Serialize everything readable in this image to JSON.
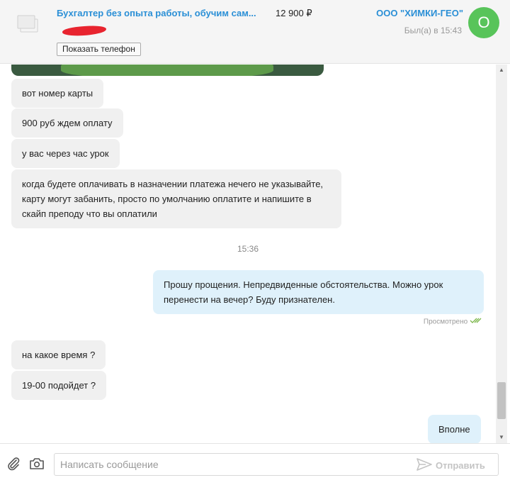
{
  "header": {
    "listing_title": "Бухгалтер без опыта работы, обучим сам...",
    "listing_price": "12 900 ₽",
    "show_phone_label": "Показать телефон",
    "company_name": "ООО \"ХИМКИ-ГЕО\"",
    "last_seen": "Был(а) в 15:43",
    "avatar_letter": "О"
  },
  "messages": [
    {
      "direction": "in",
      "text": "вот номер карты"
    },
    {
      "direction": "in",
      "text": "900 руб ждем оплату"
    },
    {
      "direction": "in",
      "text": "у вас через час урок"
    },
    {
      "direction": "in",
      "text": "когда будете оплачивать в назначении платежа нечего не указывайте, карту могут забанить, просто по умолчанию оплатите и напишите в скайп преподу что вы оплатили"
    },
    {
      "direction": "out",
      "text": "Прошу прощения. Непредвиденные обстоятельства. Можно урок перенести на вечер? Буду признателен."
    },
    {
      "direction": "in",
      "text": "на какое время ?"
    },
    {
      "direction": "in",
      "text": "19-00 подойдет ?"
    },
    {
      "direction": "out",
      "text": "Вполне"
    }
  ],
  "time_separator": "15:36",
  "read_status": "Просмотрено",
  "composer": {
    "placeholder": "Написать сообщение",
    "value": "",
    "send_label": "Отправить"
  },
  "colors": {
    "link_blue": "#2a8fd6",
    "avatar_green": "#58c45a",
    "incoming_bubble": "#f0f0f0",
    "outgoing_bubble": "#dff1fb",
    "read_check_green": "#7ab648"
  }
}
